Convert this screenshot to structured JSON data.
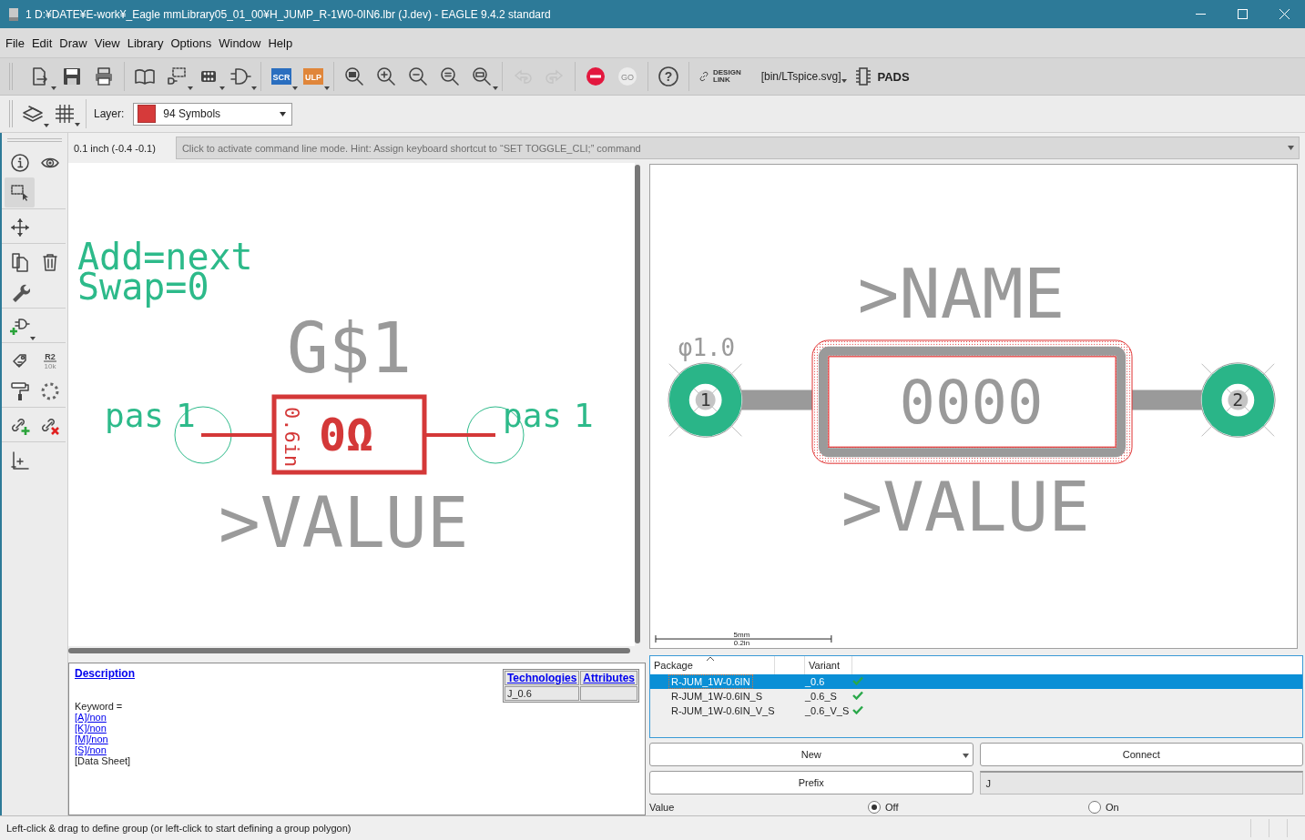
{
  "window": {
    "title": "1 D:¥DATE¥E-work¥_Eagle mmLibrary05_01_00¥H_JUMP_R-1W0-0IN6.lbr (J.dev) - EAGLE 9.4.2 standard"
  },
  "menu": [
    "File",
    "Edit",
    "Draw",
    "View",
    "Library",
    "Options",
    "Window",
    "Help"
  ],
  "toolbar": {
    "groups": [
      [
        {
          "kind": "new-file",
          "dropdown": true
        },
        {
          "kind": "save"
        },
        {
          "kind": "print"
        }
      ],
      [
        {
          "kind": "library"
        },
        {
          "kind": "package",
          "dropdown": true
        },
        {
          "kind": "footprint",
          "dropdown": true
        },
        {
          "kind": "symbol",
          "dropdown": true
        }
      ],
      [
        {
          "kind": "script",
          "label": "SCR",
          "dropdown": true
        },
        {
          "kind": "ulp",
          "label": "ULP",
          "dropdown": true
        }
      ],
      [
        {
          "kind": "zoom-fit"
        },
        {
          "kind": "zoom-in"
        },
        {
          "kind": "zoom-out"
        },
        {
          "kind": "zoom-select"
        },
        {
          "kind": "zoom-window",
          "dropdown": true
        }
      ],
      [
        {
          "kind": "undo",
          "disabled": true
        },
        {
          "kind": "redo",
          "disabled": true
        }
      ],
      [
        {
          "kind": "stop",
          "disabled": false
        },
        {
          "kind": "go",
          "label": "GO",
          "disabled": true
        }
      ],
      [
        {
          "kind": "help",
          "label": "?"
        }
      ]
    ],
    "design_link": [
      "DESIGN",
      "LINK"
    ],
    "ulp_path": "[bin/LTspice.svg]",
    "pads": "PADS"
  },
  "layer_bar": {
    "label": "Layer:",
    "layer": {
      "name": "94 Symbols",
      "color": "#d63a3a"
    }
  },
  "coordinates": "0.1 inch (-0.4 -0.1)",
  "command_line": {
    "placeholder": "Click to activate command line mode. Hint: Assign keyboard shortcut to “SET TOGGLE_CLI;” command"
  },
  "sidebar": {
    "groups": [
      [
        {
          "kind": "info",
          "selected": false
        },
        {
          "kind": "show",
          "selected": false
        },
        {
          "kind": "group",
          "selected": true
        }
      ],
      [
        {
          "kind": "move",
          "selected": false
        }
      ],
      [
        {
          "kind": "copy",
          "selected": false
        },
        {
          "kind": "delete",
          "selected": false
        },
        {
          "kind": "wrench",
          "selected": false
        }
      ],
      [
        {
          "kind": "add",
          "selected": false
        }
      ],
      [
        {
          "kind": "attribute",
          "selected": false
        },
        {
          "kind": "value",
          "labels": [
            "R2",
            "10k"
          ],
          "selected": false
        },
        {
          "kind": "paint",
          "selected": false
        },
        {
          "kind": "gate-swap",
          "selected": false
        }
      ],
      [
        {
          "kind": "connect-add",
          "selected": false
        },
        {
          "kind": "connect-remove",
          "selected": false
        }
      ],
      [
        {
          "kind": "origin",
          "selected": false
        }
      ]
    ]
  },
  "symbol_editor": {
    "add": "Add=next",
    "swap": "Swap=0",
    "name": "G$1",
    "symbol_value": "0Ω",
    "length": "0.6in",
    "value": ">VALUE",
    "pins": [
      {
        "name": "pas",
        "number": "1"
      },
      {
        "name": "pas",
        "number": "1"
      }
    ]
  },
  "package_preview": {
    "name": ">NAME",
    "drill": "φ1.0",
    "body": "0000",
    "value": ">VALUE",
    "pads": [
      "1",
      "2"
    ],
    "scale": [
      "5mm",
      "0.2in"
    ]
  },
  "description": {
    "heading": "Description",
    "keyword": "Keyword =",
    "links": [
      "[A]/non",
      "[K]/non",
      "[M]/non",
      "[S]/non"
    ],
    "datasheet": "[Data Sheet]",
    "table": {
      "columns": [
        "Technologies",
        "Attributes"
      ],
      "rows": [
        {
          "technology": "J_0.6"
        }
      ]
    }
  },
  "package_list": {
    "columns": [
      "Package",
      "Variant"
    ],
    "rows": [
      {
        "package": "R-JUM_1W-0.6IN",
        "variant": "_0.6",
        "selected": true,
        "connected": true
      },
      {
        "package": "R-JUM_1W-0.6IN_S",
        "variant": "_0.6_S",
        "selected": false,
        "connected": true
      },
      {
        "package": "R-JUM_1W-0.6IN_V_S",
        "variant": "_0.6_V_S",
        "selected": false,
        "connected": true
      }
    ]
  },
  "buttons": {
    "new": "New",
    "connect": "Connect",
    "prefix": "Prefix"
  },
  "prefix_value": "J",
  "value_row": {
    "label": "Value",
    "options": [
      {
        "label": "Off",
        "selected": true
      },
      {
        "label": "On",
        "selected": false
      }
    ]
  },
  "status": "Left-click & drag to define group (or left-click to start defining a group polygon)"
}
